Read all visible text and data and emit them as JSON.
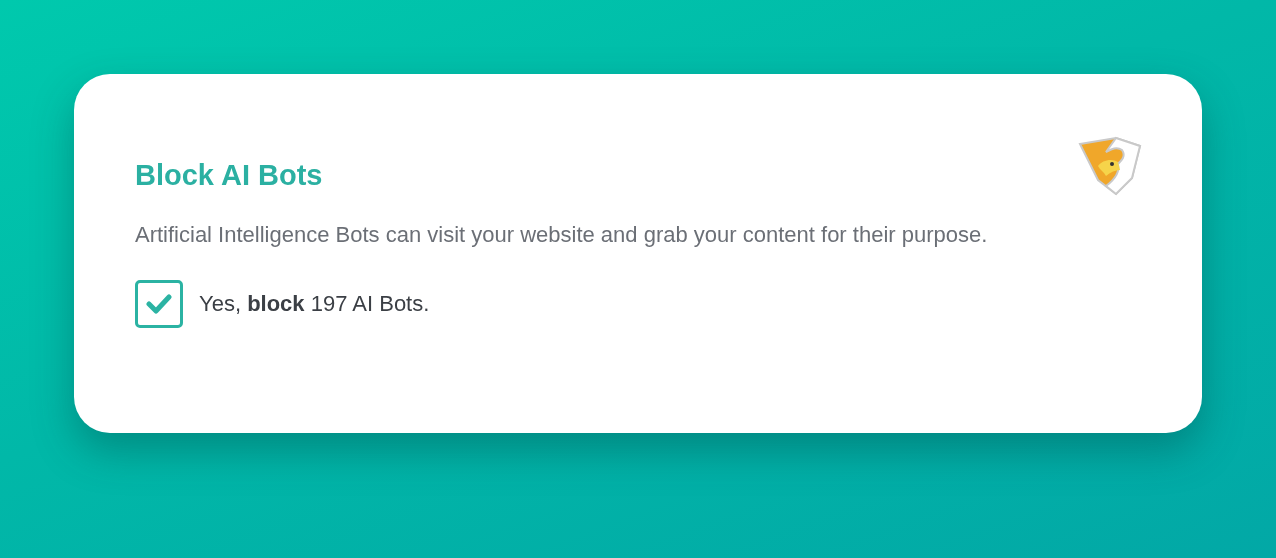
{
  "card": {
    "title": "Block AI Bots",
    "description": "Artificial Intelligence Bots can visit your website and grab your content for their purpose.",
    "option": {
      "label": "Yes, **block** 197 AI Bots.",
      "checked": true
    }
  }
}
